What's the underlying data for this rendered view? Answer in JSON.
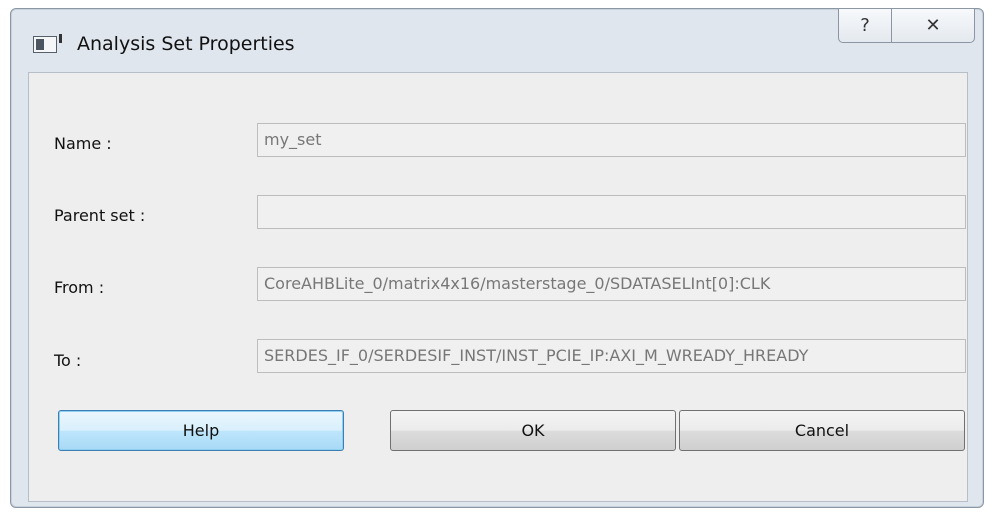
{
  "window": {
    "title": "Analysis Set Properties",
    "help_glyph": "?",
    "close_glyph": "✕"
  },
  "form": {
    "name_label": "Name :",
    "name_value": "my_set",
    "parent_label": "Parent set :",
    "parent_value": "",
    "from_label": "From :",
    "from_value": "CoreAHBLite_0/matrix4x16/masterstage_0/SDATASELInt[0]:CLK",
    "to_label": "To :",
    "to_value": "SERDES_IF_0/SERDESIF_INST/INST_PCIE_IP:AXI_M_WREADY_HREADY"
  },
  "buttons": {
    "help": "Help",
    "ok": "OK",
    "cancel": "Cancel"
  }
}
